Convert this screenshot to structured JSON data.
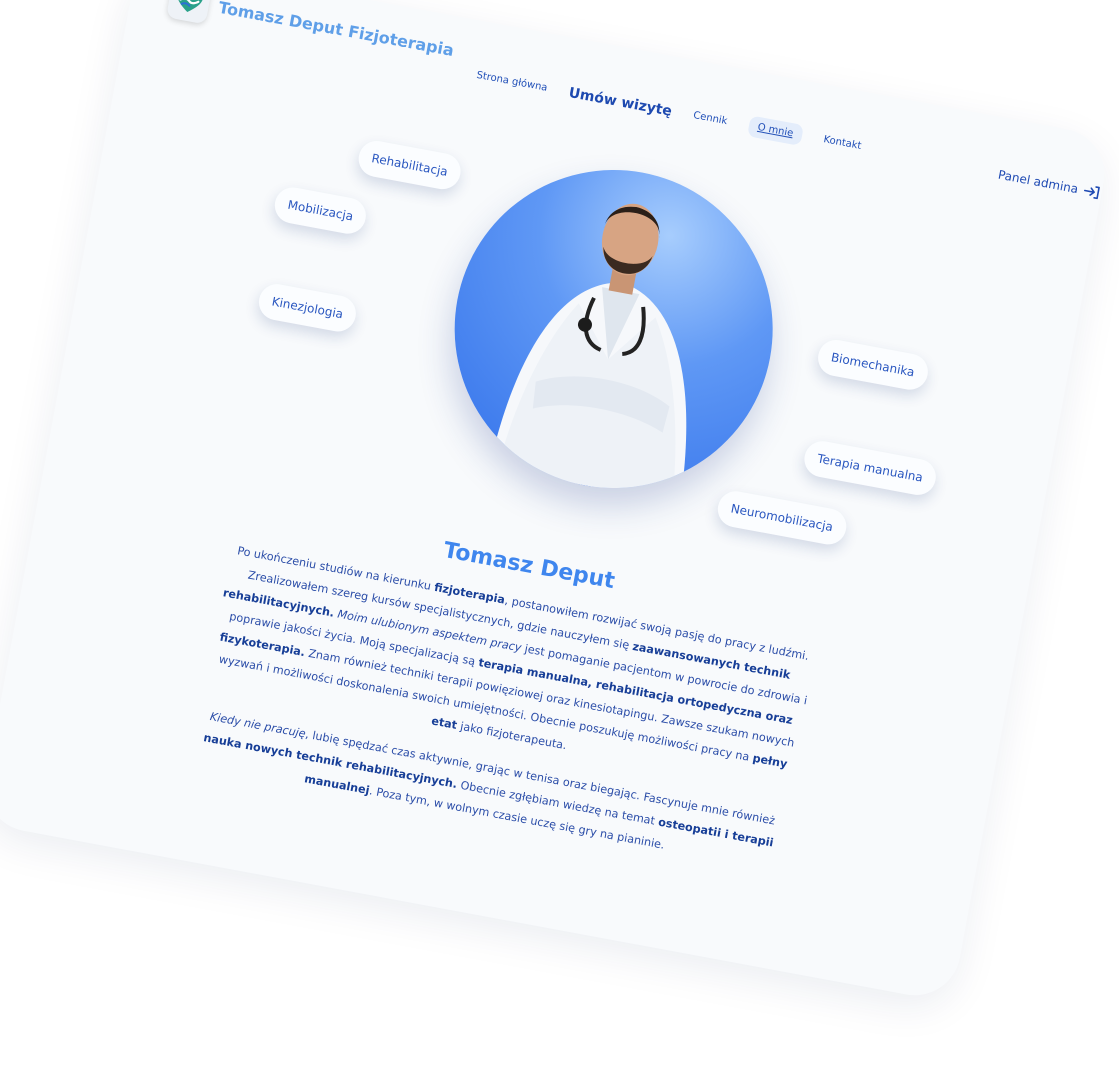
{
  "brand": {
    "name": "Tomasz Deput Fizjoterapia",
    "logo_icon": "heart-hands-icon"
  },
  "nav": {
    "home": "Strona główna",
    "book": "Umów wizytę",
    "pricing": "Cennik",
    "about": "O mnie",
    "contact": "Kontakt"
  },
  "admin": {
    "label": "Panel admina",
    "icon": "login-arrow-icon"
  },
  "tags": {
    "rehab": "Rehabilitacja",
    "mob": "Mobilizacja",
    "kinez": "Kinezjologia",
    "biomech": "Biomechanika",
    "manual": "Terapia manualna",
    "neuro": "Neuromobilizacja"
  },
  "profile": {
    "name": "Tomasz Deput",
    "p1": [
      "Po ukończeniu studiów na kierunku ",
      "fizjoterapia",
      ", postanowiłem rozwijać swoją pasję do pracy z ludźmi. Zrealizowałem szereg kursów specjalistycznych, gdzie nauczyłem się ",
      "zaawansowanych technik rehabilitacyjnych.",
      " ",
      "Moim ulubionym aspektem pracy",
      " jest pomaganie pacjentom w powrocie do zdrowia i poprawie jakości życia. Moją specjalizacją są ",
      "terapia manualna, rehabilitacja ortopedyczna oraz fizykoterapia.",
      " Znam również techniki terapii powięziowej oraz kinesiotapingu. Zawsze szukam nowych wyzwań i możliwości doskonalenia swoich umiejętności. Obecnie poszukuję możliwości pracy na ",
      "pełny etat",
      " jako fizjoterapeuta."
    ],
    "p2": [
      "Kiedy nie pracuję",
      ", lubię spędzać czas aktywnie, grając w tenisa oraz biegając. Fascynuje mnie również ",
      "nauka nowych technik rehabilitacyjnych.",
      " Obecnie zgłębiam wiedzę na temat ",
      "osteopatii i terapii manualnej",
      ". Poza tym, w wolnym czasie uczę się gry na pianinie."
    ]
  },
  "colors": {
    "accent": "#3f86ee",
    "nav": "#1d49b0",
    "card": "#f8fafc"
  }
}
